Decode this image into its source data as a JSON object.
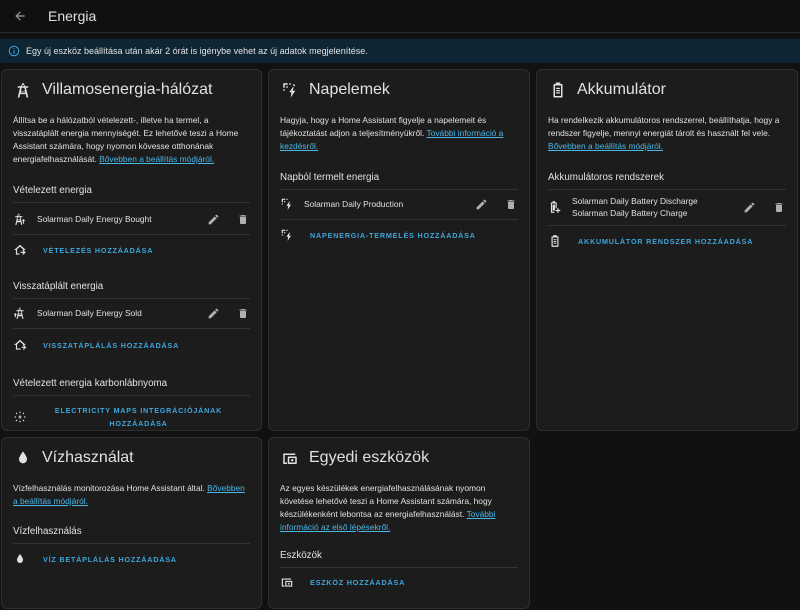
{
  "header": {
    "title": "Energia"
  },
  "info_banner": {
    "text": "Egy új eszköz beállítása után akár 2 órát is igénybe vehet az új adatok megjelenítése."
  },
  "grid": {
    "title": "Villamosenergia-hálózat",
    "description": "Állítsa be a hálózatból vételezett-, illetve ha termel, a visszatáplált energia mennyiségét. Ez lehetővé teszi a Home Assistant számára, hogy nyomon kövesse otthonának energiafelhasználását.",
    "link": "Bővebben a beállítás módjáról.",
    "consumption_title": "Vételezett energia",
    "consumption_item": "Solarman Daily Energy Bought",
    "add_consumption": "VÉTELEZÉS HOZZÁADÁSA",
    "return_title": "Visszatáplált energia",
    "return_item": "Solarman Daily Energy Sold",
    "add_return": "VISSZATÁPLÁLÁS HOZZÁADÁSA",
    "carbon_title": "Vételezett energia karbonlábnyoma",
    "add_carbon_line1": "ELECTRICITY MAPS INTEGRÁCIÓJÁNAK",
    "add_carbon_line2": "HOZZÁADÁSA"
  },
  "solar": {
    "title": "Napelemek",
    "description": "Hagyja, hogy a Home Assistant figyelje a napelemeit és tájékoztatást adjon a teljesítményükről.",
    "link": "További információ a kezdésről.",
    "production_title": "Napból termelt energia",
    "production_item": "Solarman Daily Production",
    "add_production": "NAPENERGIA-TERMELÉS HOZZÁADÁSA"
  },
  "battery": {
    "title": "Akkumulátor",
    "description": "Ha rendelkezik akkumulátoros rendszerrel, beállíthatja, hogy a rendszer figyelje, mennyi energiát tárolt és használt fel vele.",
    "link": "Bővebben a beállítás módjáról.",
    "systems_title": "Akkumulátoros rendszerek",
    "discharge_item": "Solarman Daily Battery Discharge",
    "charge_item": "Solarman Daily Battery Charge",
    "add_battery": "AKKUMULÁTOR RENDSZER HOZZÁADÁSA"
  },
  "water": {
    "title": "Vízhasználat",
    "description": "Vízfelhasználás monitorozása Home Assistant által.",
    "link": "Bővebben a beállítás módjáról.",
    "usage_title": "Vízfelhasználás",
    "add_water": "VÍZ BETÁPLÁLÁS HOZZÁADÁSA"
  },
  "devices": {
    "title": "Egyedi eszközök",
    "description": "Az egyes készülékek energiafelhasználásának nyomon követése lehetővé teszi a Home Assistant számára, hogy készülékenként lebontsa az energiafelhasználást.",
    "link": "További információ az első lépésekről.",
    "devices_title": "Eszközök",
    "add_device": "ESZKÖZ HOZZÁADÁSA"
  },
  "colors": {
    "accent": "#3da6dc",
    "link": "#4bb7e8",
    "card_bg": "#1c1c1c",
    "page_bg": "#111111",
    "banner_bg": "#0e2633"
  }
}
